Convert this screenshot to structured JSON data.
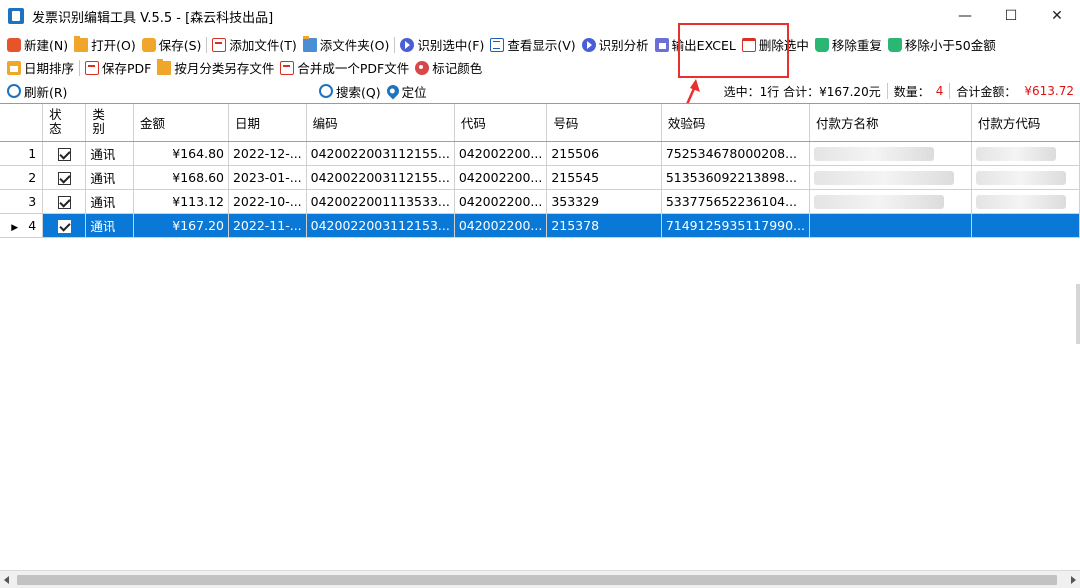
{
  "window": {
    "title": "发票识别编辑工具 V.5.5 - [森云科技出品]",
    "controls": {
      "minimize": "—",
      "maximize": "☐",
      "close": "✕"
    }
  },
  "toolbar1": [
    {
      "name": "new",
      "icon": "new-icon",
      "label": "新建(N)"
    },
    {
      "name": "open",
      "icon": "folder-icon",
      "label": "打开(O)"
    },
    {
      "name": "save",
      "icon": "save-icon",
      "label": "保存(S)"
    },
    {
      "name": "add-file",
      "icon": "pdf-icon",
      "label": "添加文件(T)"
    },
    {
      "name": "add-folder",
      "icon": "folder2-icon",
      "label": "添文件夹(O)"
    },
    {
      "name": "recognize-selected",
      "icon": "play-icon",
      "label": "识别选中(F)"
    },
    {
      "name": "view-display",
      "icon": "list-icon",
      "label": "查看显示(V)"
    },
    {
      "name": "recognize-analysis",
      "icon": "play-icon",
      "label": "识别分析"
    },
    {
      "name": "export-excel",
      "icon": "excel-icon",
      "label": "输出EXCEL"
    },
    {
      "name": "delete-selected",
      "icon": "trash-icon",
      "label": "删除选中"
    },
    {
      "name": "remove-duplicates",
      "icon": "trash-green-icon",
      "label": "移除重复"
    },
    {
      "name": "remove-under-50",
      "icon": "trash-green-icon",
      "label": "移除小于50金额"
    }
  ],
  "toolbar2": [
    {
      "name": "sort-by-date",
      "icon": "calendar-icon",
      "label": "日期排序"
    },
    {
      "name": "save-pdf",
      "icon": "pdf-icon",
      "label": "保存PDF"
    },
    {
      "name": "save-by-month",
      "icon": "folder-icon",
      "label": "按月分类另存文件"
    },
    {
      "name": "merge-pdf",
      "icon": "pdf-icon",
      "label": "合并成一个PDF文件"
    },
    {
      "name": "mark-color",
      "icon": "palette-icon",
      "label": "标记颜色"
    }
  ],
  "statusbar": {
    "refresh_label": "刷新(R)",
    "search_label": "搜索(Q)",
    "locate_label": "定位",
    "selected_text": "选中：1行 合计：¥167.20元",
    "count_label": "数量：",
    "count_value": "4",
    "total_label": "合计金额：",
    "total_value": "¥613.72"
  },
  "table": {
    "columns": {
      "status": "状态",
      "category": "类别",
      "amount": "金额",
      "date": "日期",
      "code": "编码",
      "dm": "代码",
      "number": "号码",
      "check_code": "效验码",
      "payer_name": "付款方名称",
      "payer_code": "付款方代码"
    },
    "rows": [
      {
        "idx": "1",
        "category": "通讯",
        "amount": "¥164.80",
        "date": "2022-12-...",
        "code": "0420022003112155...",
        "dm": "042002200...",
        "number": "215506",
        "check_code": "752534678000208..."
      },
      {
        "idx": "2",
        "category": "通讯",
        "amount": "¥168.60",
        "date": "2023-01-...",
        "code": "0420022003112155...",
        "dm": "042002200...",
        "number": "215545",
        "check_code": "513536092213898..."
      },
      {
        "idx": "3",
        "category": "通讯",
        "amount": "¥113.12",
        "date": "2022-10-...",
        "code": "0420022001113533...",
        "dm": "042002200...",
        "number": "353329",
        "check_code": "533775652236104..."
      },
      {
        "idx": "4",
        "category": "通讯",
        "amount": "¥167.20",
        "date": "2022-11-...",
        "code": "0420022003112153...",
        "dm": "042002200...",
        "number": "215378",
        "check_code": "7149125935117990..."
      }
    ]
  },
  "colors": {
    "selection": "#0a78d6",
    "highlight_box": "#e8312f",
    "total_text": "#e01010"
  }
}
